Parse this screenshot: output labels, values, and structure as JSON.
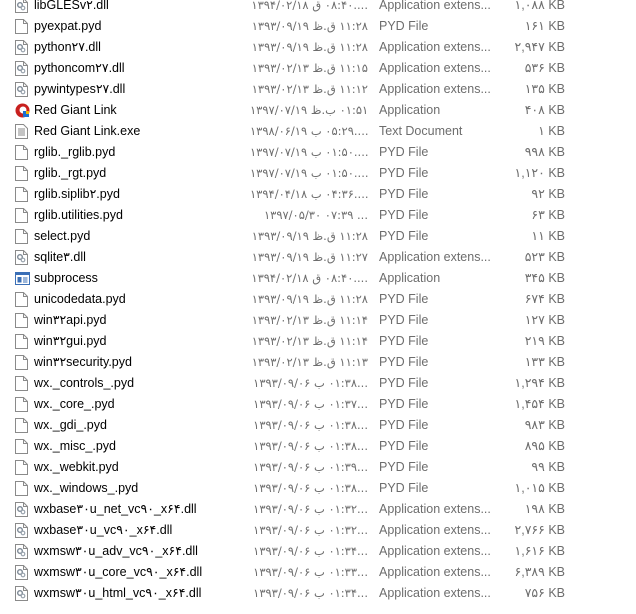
{
  "colors": {
    "name_text": "#000000",
    "detail_text": "#6d6d6d"
  },
  "files": [
    {
      "name": "libGLESv۲.dll",
      "date": "۱۳۹۴/۰۲/۱۸ ق ۰۸:۴۰....",
      "type": "Application extens...",
      "size": "۱,۰۸۸ KB",
      "icon": "dll-file-icon"
    },
    {
      "name": "pyexpat.pyd",
      "date": "۱۳۹۳/۰۹/۱۹ ظ.ق ۱۱:۲۸",
      "type": "PYD File",
      "size": "۱۶۱ KB",
      "icon": "blank-file-icon"
    },
    {
      "name": "python۲۷.dll",
      "date": "۱۳۹۳/۰۹/۱۹ ظ.ق ۱۱:۲۸",
      "type": "Application extens...",
      "size": "۲,۹۴۷ KB",
      "icon": "dll-file-icon"
    },
    {
      "name": "pythoncom۲۷.dll",
      "date": "۱۳۹۳/۰۲/۱۳ ظ.ق ۱۱:۱۵",
      "type": "Application extens...",
      "size": "۵۳۶ KB",
      "icon": "dll-file-icon"
    },
    {
      "name": "pywintypes۲۷.dll",
      "date": "۱۳۹۳/۰۲/۱۳ ظ.ق ۱۱:۱۲",
      "type": "Application extens...",
      "size": "۱۳۵ KB",
      "icon": "dll-file-icon"
    },
    {
      "name": "Red Giant Link",
      "date": "۱۳۹۷/۰۷/۱۹ ظ.ب ۰۱:۵۱",
      "type": "Application",
      "size": "۴۰۸ KB",
      "icon": "red-giant-app-icon"
    },
    {
      "name": "Red Giant Link.exe",
      "date": "۱۳۹۸/۰۶/۱۹ ب ۰۵:۲۹....",
      "type": "Text Document",
      "size": "۱ KB",
      "icon": "text-file-icon"
    },
    {
      "name": "rglib._rglib.pyd",
      "date": "۱۳۹۷/۰۷/۱۹ ب ۰۱:۵۰....",
      "type": "PYD File",
      "size": "۹۹۸ KB",
      "icon": "blank-file-icon"
    },
    {
      "name": "rglib._rgt.pyd",
      "date": "۱۳۹۷/۰۷/۱۹ ب ۰۱:۵۰....",
      "type": "PYD File",
      "size": "۱,۱۲۰ KB",
      "icon": "blank-file-icon"
    },
    {
      "name": "rglib.siplib۲.pyd",
      "date": "۱۳۹۴/۰۴/۱۸ ب ۰۴:۳۶....",
      "type": "PYD File",
      "size": "۹۲ KB",
      "icon": "blank-file-icon"
    },
    {
      "name": "rglib.utilities.pyd",
      "date": "۱۳۹۷/۰۵/۳۰ ۰۷:۳۹ ...",
      "type": "PYD File",
      "size": "۶۳ KB",
      "icon": "blank-file-icon"
    },
    {
      "name": "select.pyd",
      "date": "۱۳۹۳/۰۹/۱۹ ظ.ق ۱۱:۲۸",
      "type": "PYD File",
      "size": "۱۱ KB",
      "icon": "blank-file-icon"
    },
    {
      "name": "sqlite۳.dll",
      "date": "۱۳۹۳/۰۹/۱۹ ظ.ق ۱۱:۲۷",
      "type": "Application extens...",
      "size": "۵۲۳ KB",
      "icon": "dll-file-icon"
    },
    {
      "name": "subprocess",
      "date": "۱۳۹۴/۰۲/۱۸ ق ۰۸:۴۰....",
      "type": "Application",
      "size": "۳۴۵ KB",
      "icon": "window-app-icon"
    },
    {
      "name": "unicodedata.pyd",
      "date": "۱۳۹۳/۰۹/۱۹ ظ.ق ۱۱:۲۸",
      "type": "PYD File",
      "size": "۶۷۴ KB",
      "icon": "blank-file-icon"
    },
    {
      "name": "win۳۲api.pyd",
      "date": "۱۳۹۳/۰۲/۱۳ ظ.ق ۱۱:۱۴",
      "type": "PYD File",
      "size": "۱۲۷ KB",
      "icon": "blank-file-icon"
    },
    {
      "name": "win۳۲gui.pyd",
      "date": "۱۳۹۳/۰۲/۱۳ ظ.ق ۱۱:۱۴",
      "type": "PYD File",
      "size": "۲۱۹ KB",
      "icon": "blank-file-icon"
    },
    {
      "name": "win۳۲security.pyd",
      "date": "۱۳۹۳/۰۲/۱۳ ظ.ق ۱۱:۱۳",
      "type": "PYD File",
      "size": "۱۳۳ KB",
      "icon": "blank-file-icon"
    },
    {
      "name": "wx._controls_.pyd",
      "date": "۱۳۹۳/۰۹/۰۶ ب ۰۱:۳۸...",
      "type": "PYD File",
      "size": "۱,۲۹۴ KB",
      "icon": "blank-file-icon"
    },
    {
      "name": "wx._core_.pyd",
      "date": "۱۳۹۳/۰۹/۰۶ ب ۰۱:۳۷...",
      "type": "PYD File",
      "size": "۱,۴۵۴ KB",
      "icon": "blank-file-icon"
    },
    {
      "name": "wx._gdi_.pyd",
      "date": "۱۳۹۳/۰۹/۰۶ ب ۰۱:۳۸...",
      "type": "PYD File",
      "size": "۹۸۳ KB",
      "icon": "blank-file-icon"
    },
    {
      "name": "wx._misc_.pyd",
      "date": "۱۳۹۳/۰۹/۰۶ ب ۰۱:۳۸...",
      "type": "PYD File",
      "size": "۸۹۵ KB",
      "icon": "blank-file-icon"
    },
    {
      "name": "wx._webkit.pyd",
      "date": "۱۳۹۳/۰۹/۰۶ ب ۰۱:۳۹...",
      "type": "PYD File",
      "size": "۹۹ KB",
      "icon": "blank-file-icon"
    },
    {
      "name": "wx._windows_.pyd",
      "date": "۱۳۹۳/۰۹/۰۶ ب ۰۱:۳۸...",
      "type": "PYD File",
      "size": "۱,۰۱۵ KB",
      "icon": "blank-file-icon"
    },
    {
      "name": "wxbase۳۰u_net_vc۹۰_x۶۴.dll",
      "date": "۱۳۹۳/۰۹/۰۶ ب ۰۱:۳۲...",
      "type": "Application extens...",
      "size": "۱۹۸ KB",
      "icon": "dll-file-icon"
    },
    {
      "name": "wxbase۳۰u_vc۹۰_x۶۴.dll",
      "date": "۱۳۹۳/۰۹/۰۶ ب ۰۱:۳۲...",
      "type": "Application extens...",
      "size": "۲,۷۶۶ KB",
      "icon": "dll-file-icon"
    },
    {
      "name": "wxmsw۳۰u_adv_vc۹۰_x۶۴.dll",
      "date": "۱۳۹۳/۰۹/۰۶ ب ۰۱:۳۴...",
      "type": "Application extens...",
      "size": "۱,۶۱۶ KB",
      "icon": "dll-file-icon"
    },
    {
      "name": "wxmsw۳۰u_core_vc۹۰_x۶۴.dll",
      "date": "۱۳۹۳/۰۹/۰۶ ب ۰۱:۳۳...",
      "type": "Application extens...",
      "size": "۶,۳۸۹ KB",
      "icon": "dll-file-icon"
    },
    {
      "name": "wxmsw۳۰u_html_vc۹۰_x۶۴.dll",
      "date": "۱۳۹۳/۰۹/۰۶ ب ۰۱:۳۴...",
      "type": "Application extens...",
      "size": "۷۵۶ KB",
      "icon": "dll-file-icon"
    }
  ]
}
